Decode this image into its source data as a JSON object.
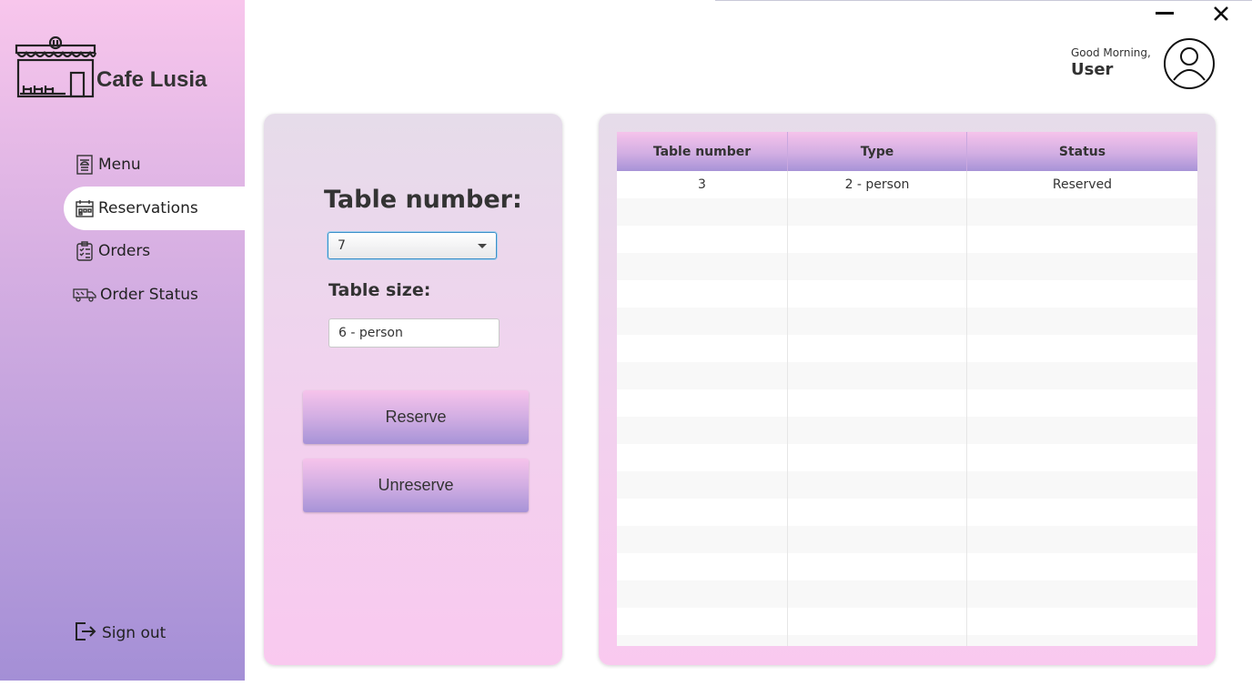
{
  "app": {
    "name": "Cafe Lusia",
    "logo_icon": "cafe-storefront-icon"
  },
  "window": {
    "minimize_icon": "minimize-icon",
    "close_icon": "close-icon"
  },
  "sidebar": {
    "items": [
      {
        "label": "Menu",
        "icon": "menu-book-icon"
      },
      {
        "label": "Reservations",
        "icon": "calendar-icon",
        "active": true
      },
      {
        "label": "Orders",
        "icon": "clipboard-checklist-icon"
      },
      {
        "label": "Order Status",
        "icon": "delivery-truck-icon"
      }
    ],
    "signout": {
      "label": "Sign out",
      "icon": "sign-out-icon"
    }
  },
  "header": {
    "greeting": "Good Morning,",
    "user": "User",
    "avatar_icon": "user-avatar-icon"
  },
  "form": {
    "table_number_label": "Table number:",
    "table_number_value": "7",
    "table_size_label": "Table size:",
    "table_size_value": "6 - person",
    "reserve_label": "Reserve",
    "unreserve_label": "Unreserve"
  },
  "table": {
    "columns": [
      "Table number",
      "Type",
      "Status"
    ],
    "rows": [
      [
        "3",
        "2 - person",
        "Reserved"
      ]
    ]
  },
  "colors": {
    "sidebar_top": "#f8c6ec",
    "sidebar_bottom": "#a48fd6",
    "button_top": "#f6c3eb",
    "button_bottom": "#a793d7",
    "focus_border": "#3b8ec9"
  }
}
